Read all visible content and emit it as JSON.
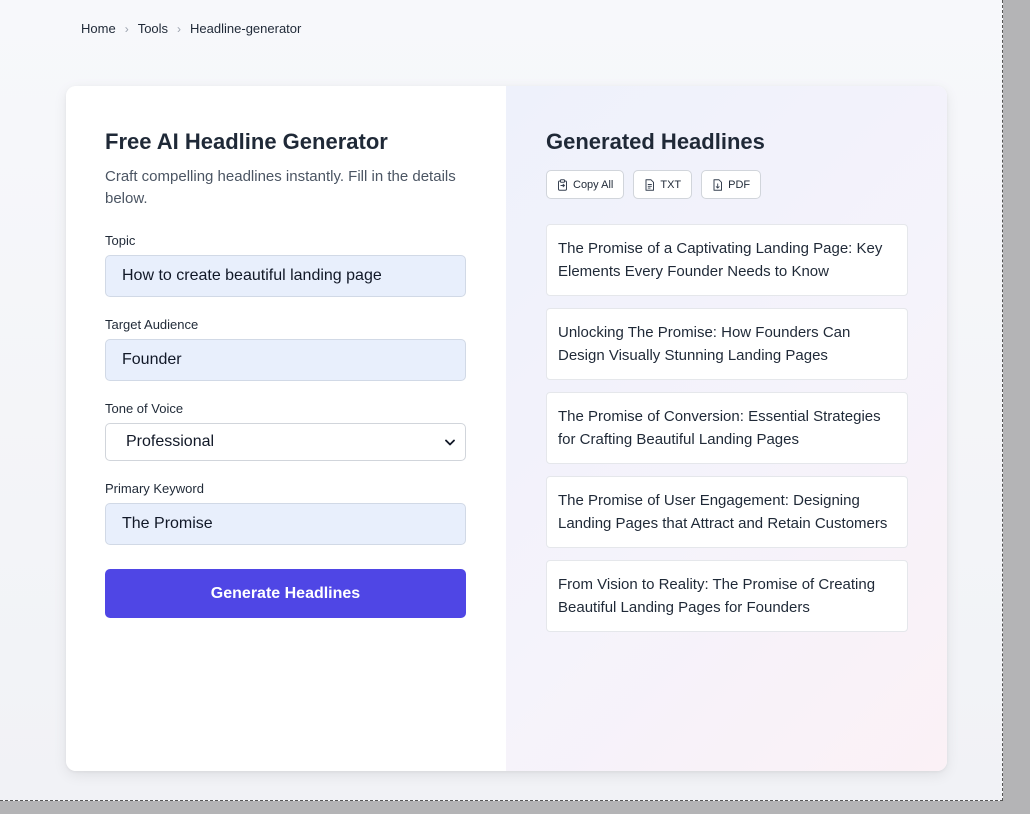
{
  "breadcrumb": {
    "items": [
      "Home",
      "Tools",
      "Headline-generator"
    ],
    "separator": ">"
  },
  "form": {
    "title": "Free AI Headline Generator",
    "subtitle": "Craft compelling headlines instantly. Fill in the details below.",
    "fields": {
      "topic": {
        "label": "Topic",
        "value": "How to create beautiful landing page"
      },
      "audience": {
        "label": "Target Audience",
        "value": "Founder"
      },
      "tone": {
        "label": "Tone of Voice",
        "value": "Professional"
      },
      "keyword": {
        "label": "Primary Keyword",
        "value": "The Promise"
      }
    },
    "submit_label": "Generate Headlines"
  },
  "results": {
    "title": "Generated Headlines",
    "actions": {
      "copy_all": "Copy All",
      "txt": "TXT",
      "pdf": "PDF"
    },
    "headlines": [
      "The Promise of a Captivating Landing Page: Key Elements Every Founder Needs to Know",
      "Unlocking The Promise: How Founders Can Design Visually Stunning Landing Pages",
      "The Promise of Conversion: Essential Strategies for Crafting Beautiful Landing Pages",
      "The Promise of User Engagement: Designing Landing Pages that Attract and Retain Customers",
      "From Vision to Reality: The Promise of Creating Beautiful Landing Pages for Founders"
    ]
  },
  "icons": {
    "copy": "clipboard-icon",
    "txt": "document-icon",
    "pdf": "file-download-icon",
    "select": "chevron-down-icon"
  },
  "colors": {
    "primary": "#4f46e5",
    "input_bg": "#e8effc",
    "text": "#1f2937"
  }
}
